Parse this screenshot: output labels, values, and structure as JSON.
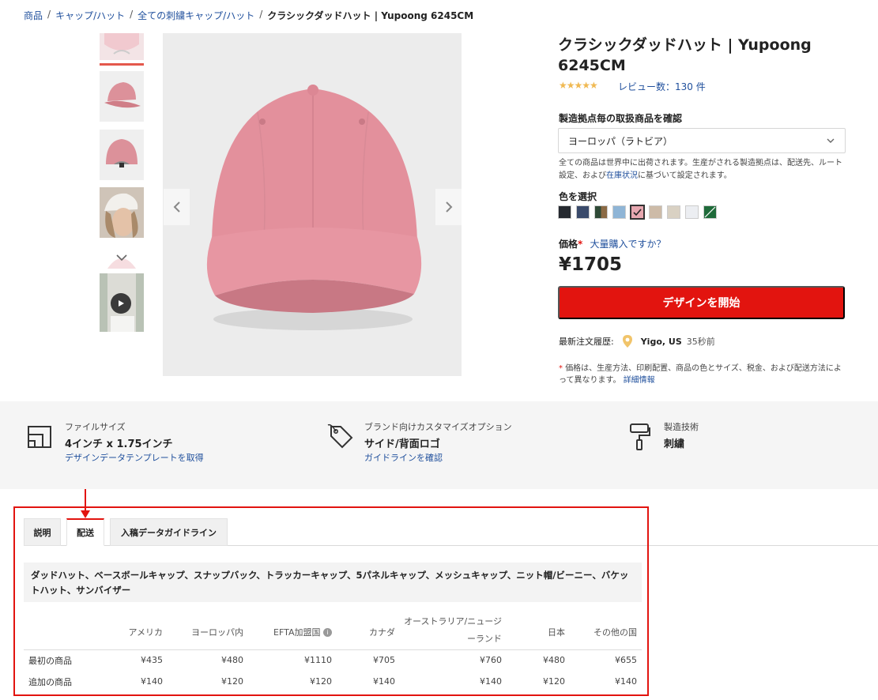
{
  "breadcrumb": [
    {
      "label": "商品"
    },
    {
      "label": "キャップ/ハット"
    },
    {
      "label": "全ての刺繍キャップ/ハット"
    },
    {
      "label": "クラシックダッドハット | Yupoong 6245CM"
    }
  ],
  "product": {
    "title": "クラシックダッドハット | Yupoong 6245CM",
    "rating": 4.5,
    "stars": "★★★★★",
    "reviews_label": "レビュー数：130 件"
  },
  "location": {
    "label": "製造拠点毎の取扱商品を確認",
    "selected": "ヨーロッパ（ラトビア）",
    "note_prefix": "全ての商品は世界中に出荷されます。生産がされる製造拠点は、配送先、ルート設定、および",
    "note_link": "在庫状況",
    "note_suffix": "に基づいて設定されます。"
  },
  "color": {
    "label": "色を選択",
    "swatches": [
      "#25292f",
      "#3a4a6b",
      "#5f5a3e",
      "#8fb5d6",
      "#e7a7b0",
      "#cdbba8",
      "#d9d1c3",
      "#eceef2",
      "#1f6b3a"
    ],
    "selected_index": 4
  },
  "price": {
    "label": "価格",
    "required_mark": "*",
    "bulk_link": "大量購入ですか？",
    "value": "¥1705"
  },
  "cta_label": "デザインを開始",
  "recent_order": {
    "label": "最新注文履歴:",
    "place": "Yigo, US",
    "time": "35秒前"
  },
  "price_note": {
    "mark": "*",
    "text": "価格は、生産方法、印刷配置、商品の色とサイズ、税金、および配送方法によって異なります。",
    "link": "詳細情報"
  },
  "features": [
    {
      "title": "ファイルサイズ",
      "value": "4インチ x 1.75インチ",
      "link": "デザインデータテンプレートを取得",
      "icon": "file-size-icon"
    },
    {
      "title": "ブランド向けカスタマイズオプション",
      "value": "サイド/背面ロゴ",
      "link": "ガイドラインを確認",
      "icon": "tag-icon"
    },
    {
      "title": "製造技術",
      "value": "刺繍",
      "link": "",
      "icon": "paint-roller-icon"
    }
  ],
  "tabs": [
    {
      "label": "説明"
    },
    {
      "label": "配送"
    },
    {
      "label": "入稿データガイドライン"
    }
  ],
  "shipping": {
    "product_types": "ダッドハット、ベースボールキャップ、スナップバック、トラッカーキャップ、5パネルキャップ、メッシュキャップ、ニット帽/ビーニー、バケットハット、サンバイザー",
    "columns": [
      "アメリカ",
      "ヨーロッパ内",
      "EFTA加盟国",
      "カナダ",
      "オーストラリア/ニュージーランド",
      "日本",
      "その他の国"
    ],
    "rows": [
      {
        "label": "最初の商品",
        "values": [
          "¥435",
          "¥480",
          "¥1110",
          "¥705",
          "¥760",
          "¥480",
          "¥655"
        ]
      },
      {
        "label": "追加の商品",
        "values": [
          "¥140",
          "¥120",
          "¥120",
          "¥140",
          "¥140",
          "¥120",
          "¥140"
        ]
      }
    ]
  }
}
